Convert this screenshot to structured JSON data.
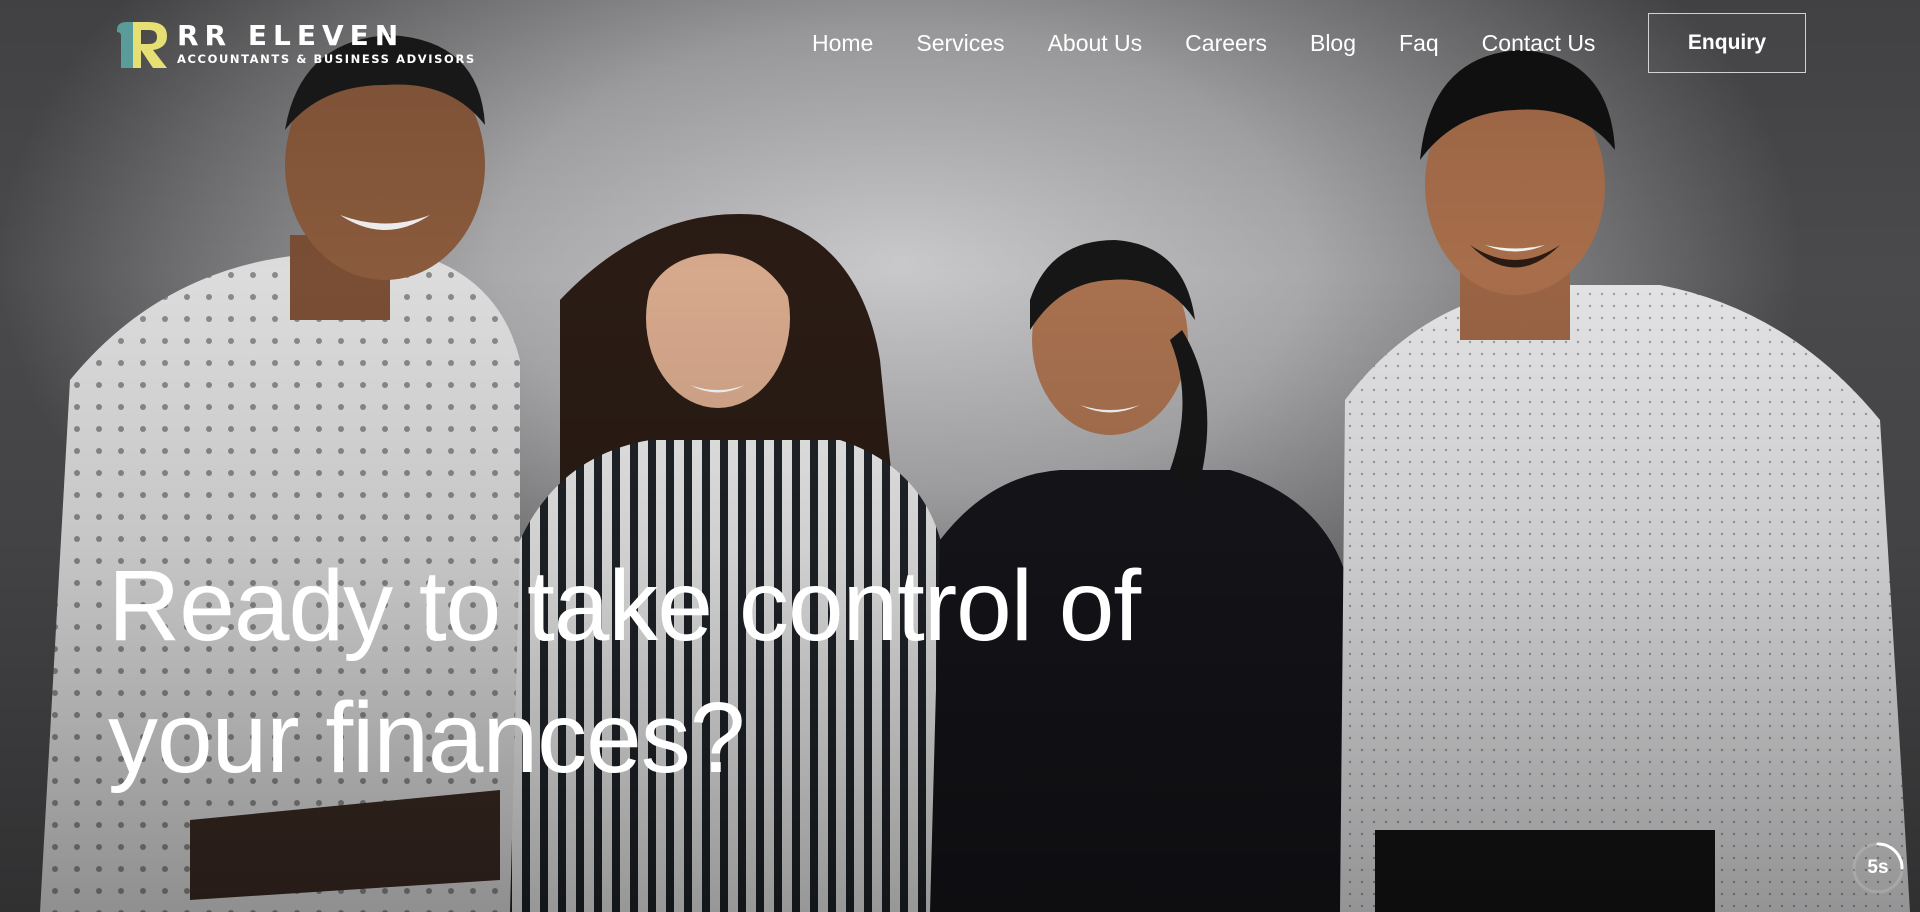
{
  "brand": {
    "name": "RR ELEVEN",
    "tagline": "ACCOUNTANTS & BUSINESS ADVISORS",
    "colors": {
      "teal": "#5a9c9a",
      "yellow": "#e6df73"
    }
  },
  "nav": {
    "items": [
      {
        "label": "Home"
      },
      {
        "label": "Services"
      },
      {
        "label": "About Us"
      },
      {
        "label": "Careers"
      },
      {
        "label": "Blog"
      },
      {
        "label": "Faq"
      },
      {
        "label": "Contact Us"
      }
    ],
    "enquiry_label": "Enquiry"
  },
  "hero": {
    "headline_line1": "Ready to take control of",
    "headline_line2": "your finances?",
    "slider_timer": "5s",
    "slider_progress": 0.25
  }
}
